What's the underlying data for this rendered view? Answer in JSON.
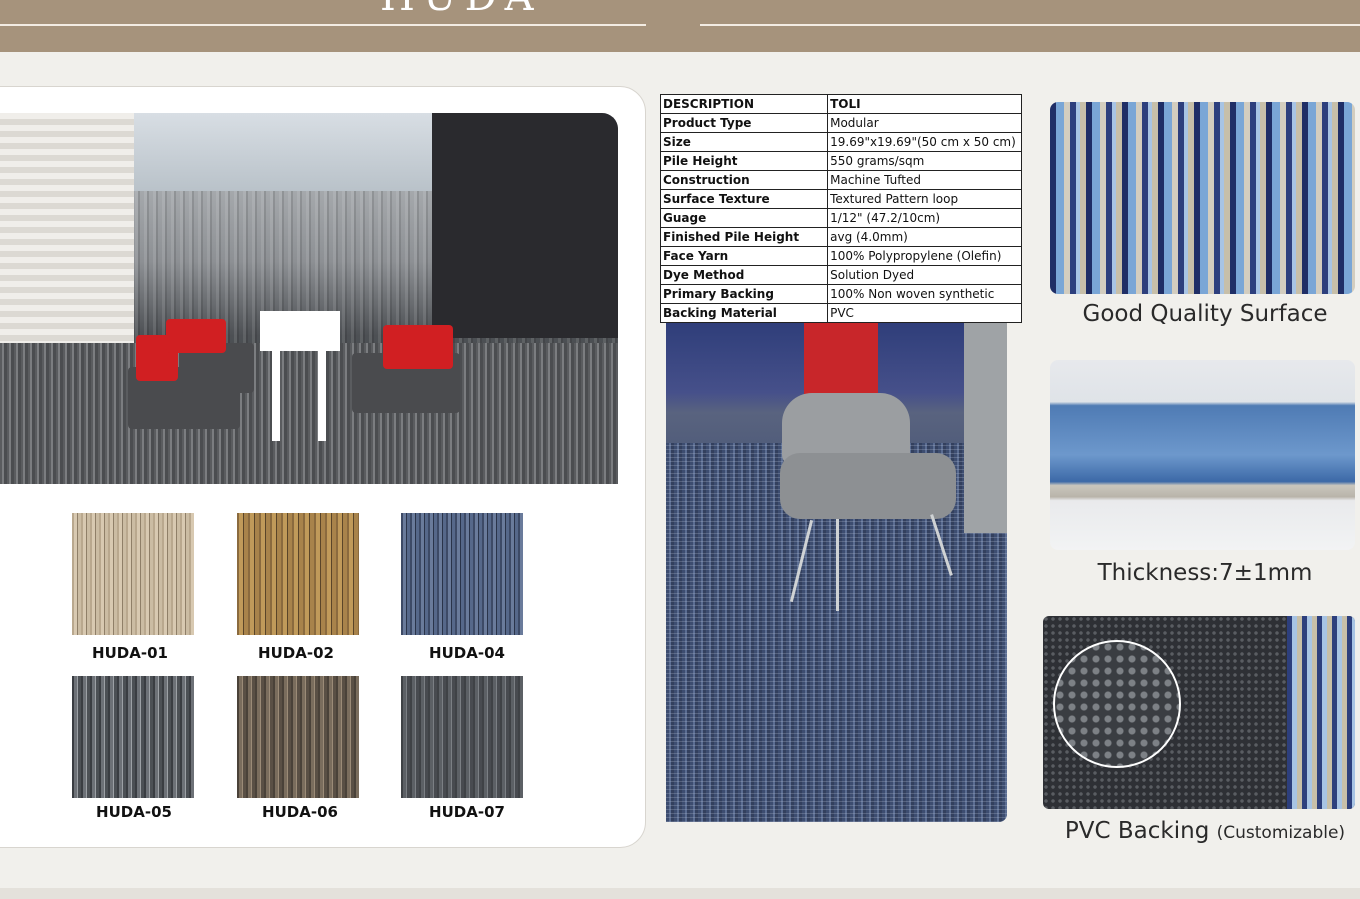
{
  "header": {
    "title_fragment": "HUDA"
  },
  "swatches": [
    {
      "code": "HUDA-01"
    },
    {
      "code": "HUDA-02"
    },
    {
      "code": "HUDA-04"
    },
    {
      "code": "HUDA-05"
    },
    {
      "code": "HUDA-06"
    },
    {
      "code": "HUDA-07"
    }
  ],
  "spec_table": {
    "header": {
      "key": "DESCRIPTION",
      "value": "TOLI"
    },
    "rows": [
      {
        "key": "Product Type",
        "value": "Modular"
      },
      {
        "key": "Size",
        "value": "19.69\"x19.69\"(50 cm x 50 cm)"
      },
      {
        "key": "Pile Height",
        "value": "550 grams/sqm"
      },
      {
        "key": "Construction",
        "value": "Machine Tufted"
      },
      {
        "key": "Surface Texture",
        "value": "Textured Pattern loop"
      },
      {
        "key": "Guage",
        "value": "1/12\" (47.2/10cm)"
      },
      {
        "key": "Finished Pile Height",
        "value": "avg (4.0mm)"
      },
      {
        "key": "Face Yarn",
        "value": "100% Polypropylene (Olefin)"
      },
      {
        "key": "Dye Method",
        "value": "Solution Dyed"
      },
      {
        "key": "Primary Backing",
        "value": "100% Non woven synthetic"
      },
      {
        "key": "Backing Material",
        "value": "PVC"
      }
    ]
  },
  "details": {
    "surface_caption": "Good Quality Surface",
    "thickness_caption": "Thickness:7±1mm",
    "backing_caption": "PVC Backing",
    "backing_note": "(Customizable)"
  },
  "colors": {
    "header_band": "#a6937c",
    "page_bg": "#f1f0ec",
    "accent_red": "#d11f22",
    "carpet_blue": "#4b5877"
  }
}
